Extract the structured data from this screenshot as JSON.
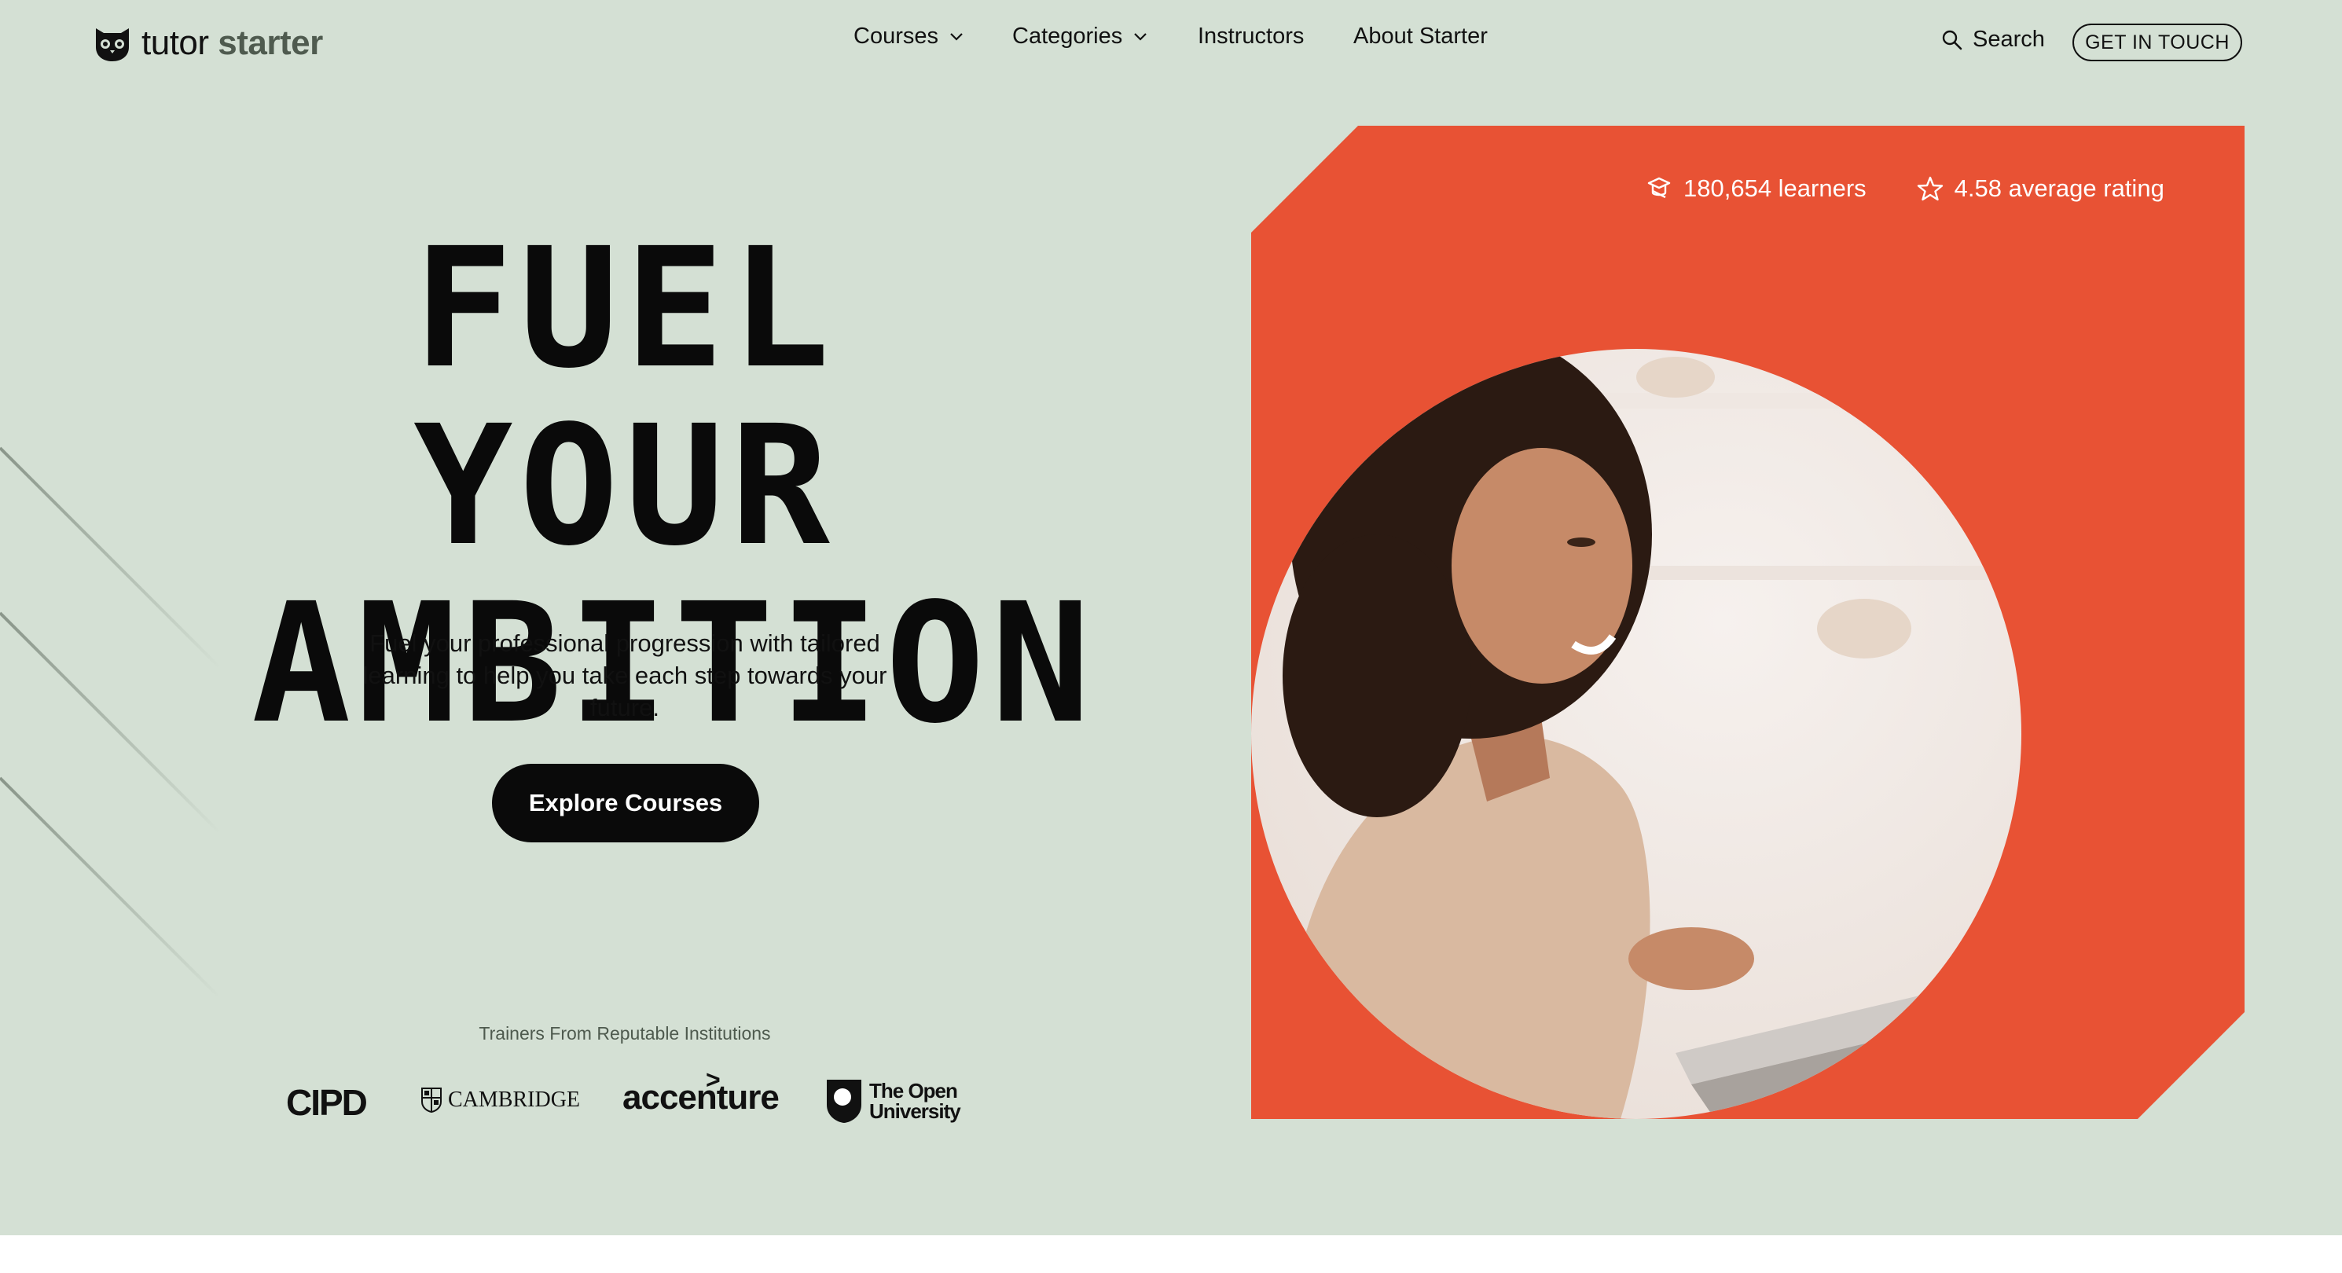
{
  "brand": {
    "word1": "tutor",
    "word2": "starter"
  },
  "nav": {
    "courses": "Courses",
    "categories": "Categories",
    "instructors": "Instructors",
    "about": "About Starter"
  },
  "header": {
    "search_label": "Search",
    "cta_label": "GET IN TOUCH"
  },
  "hero": {
    "headline_line1": "FUEL YOUR",
    "headline_line2": "AMBITION",
    "subtext": "Fuel your professional progression with tailored learning to help you take each step towards your future.",
    "explore_label": "Explore Courses",
    "trainers_label": "Trainers From Reputable Institutions"
  },
  "partners": {
    "cipd": "CIPD",
    "cambridge": "CAMBRIDGE",
    "accenture": "accenture",
    "open_line1": "The Open",
    "open_line2": "University"
  },
  "stats": {
    "learners": "180,654 learners",
    "rating": "4.58 average rating"
  },
  "colors": {
    "background": "#d4e0d4",
    "accent": "#e85234",
    "dark": "#0a0a0a"
  },
  "icons": [
    "owl-logo-icon",
    "chevron-down-icon",
    "search-icon",
    "graduation-cap-icon",
    "star-icon"
  ]
}
